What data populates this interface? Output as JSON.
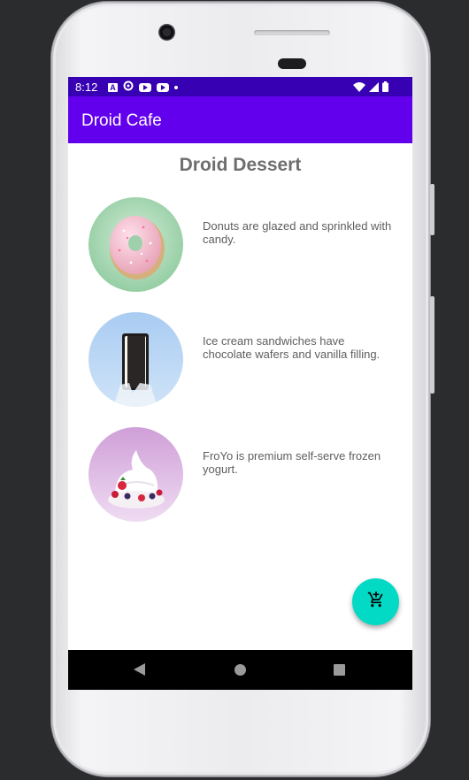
{
  "status_bar": {
    "time": "8:12",
    "icons": [
      "text-a-icon",
      "sync-icon",
      "youtube-icon",
      "youtube-icon",
      "notification-dot-icon",
      "wifi-icon",
      "signal-icon",
      "battery-icon"
    ]
  },
  "app_bar": {
    "title": "Droid Cafe"
  },
  "page": {
    "title": "Droid Dessert"
  },
  "desserts": [
    {
      "name": "donut",
      "description": "Donuts are glazed and sprinkled with candy."
    },
    {
      "name": "ice-cream-sandwich",
      "description": "Ice cream sandwiches have chocolate wafers and vanilla filling."
    },
    {
      "name": "froyo",
      "description": "FroYo is premium self-serve frozen yogurt."
    }
  ],
  "fab": {
    "icon": "add-shopping-cart-icon",
    "color": "#03dac5"
  },
  "colors": {
    "status_bar": "#3700b3",
    "app_bar": "#6200ee",
    "accent": "#03dac5"
  },
  "navigation": {
    "icons": [
      "back-icon",
      "home-icon",
      "recents-icon"
    ]
  }
}
